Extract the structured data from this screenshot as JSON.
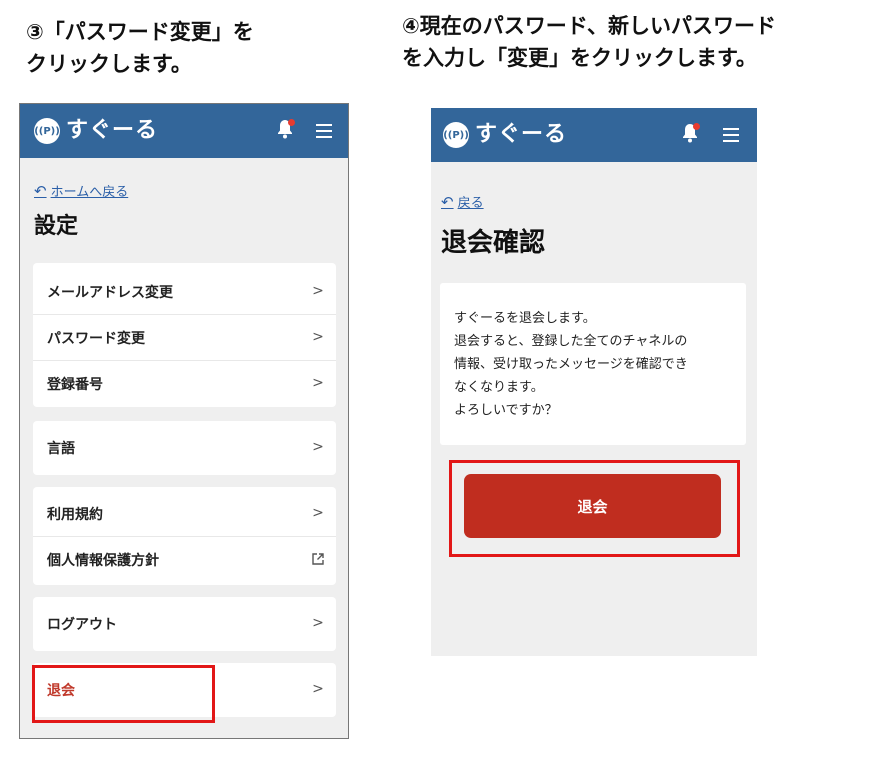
{
  "captions": {
    "left_line1": "③「パスワード変更」を",
    "left_line2": "クリックします。",
    "right_line1": "④現在のパスワード、新しいパスワード",
    "right_line2": "を入力し「変更」をクリックします。"
  },
  "app": {
    "logo_mark": "((P))",
    "logo_text": "すぐーる",
    "brand_color": "#33669a",
    "danger_color": "#c02d1f",
    "highlight_color": "#e21717"
  },
  "settings_screen": {
    "back_label": "ホームへ戻る",
    "title": "設定",
    "groups": [
      {
        "items": [
          {
            "label": "メールアドレス変更",
            "icon": "chevron-right-icon"
          },
          {
            "label": "パスワード変更",
            "icon": "chevron-right-icon"
          },
          {
            "label": "登録番号",
            "icon": "chevron-right-icon"
          }
        ]
      },
      {
        "items": [
          {
            "label": "言語",
            "icon": "chevron-right-icon"
          }
        ]
      },
      {
        "items": [
          {
            "label": "利用規約",
            "icon": "chevron-right-icon"
          },
          {
            "label": "個人情報保護方針",
            "icon": "external-link-icon"
          }
        ]
      },
      {
        "items": [
          {
            "label": "ログアウト",
            "icon": "chevron-right-icon"
          }
        ]
      },
      {
        "items": [
          {
            "label": "退会",
            "icon": "chevron-right-icon"
          }
        ]
      }
    ]
  },
  "withdraw_screen": {
    "back_label": "戻る",
    "title": "退会確認",
    "message_lines": [
      "すぐーるを退会します。",
      "退会すると、登録した全てのチャネルの",
      "情報、受け取ったメッセージを確認でき",
      "なくなります。",
      "よろしいですか？"
    ],
    "button_label": "退会"
  }
}
